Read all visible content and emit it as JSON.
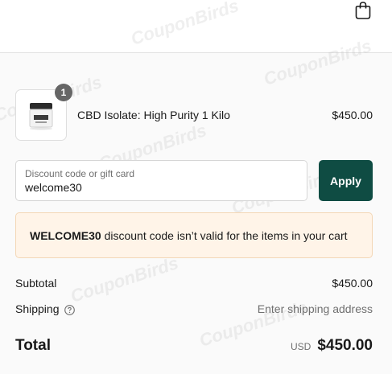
{
  "header": {
    "cart_icon": "shopping-bag-icon"
  },
  "line_item": {
    "quantity": "1",
    "name": "CBD Isolate: High Purity 1 Kilo",
    "price": "$450.00"
  },
  "discount": {
    "label": "Discount code or gift card",
    "value": "welcome30",
    "apply_label": "Apply"
  },
  "alert": {
    "code": "WELCOME30",
    "message": " discount code isn’t valid for the items in your cart"
  },
  "summary": {
    "subtotal_label": "Subtotal",
    "subtotal_value": "$450.00",
    "shipping_label": "Shipping",
    "shipping_value": "Enter shipping address",
    "total_label": "Total",
    "total_currency": "USD",
    "total_value": "$450.00"
  },
  "watermark": "CouponBirds",
  "colors": {
    "accent": "#0f4c43",
    "badge": "#666666",
    "alert_bg": "#fff4e8",
    "alert_border": "#f3d7b6",
    "muted_text": "#707070"
  }
}
